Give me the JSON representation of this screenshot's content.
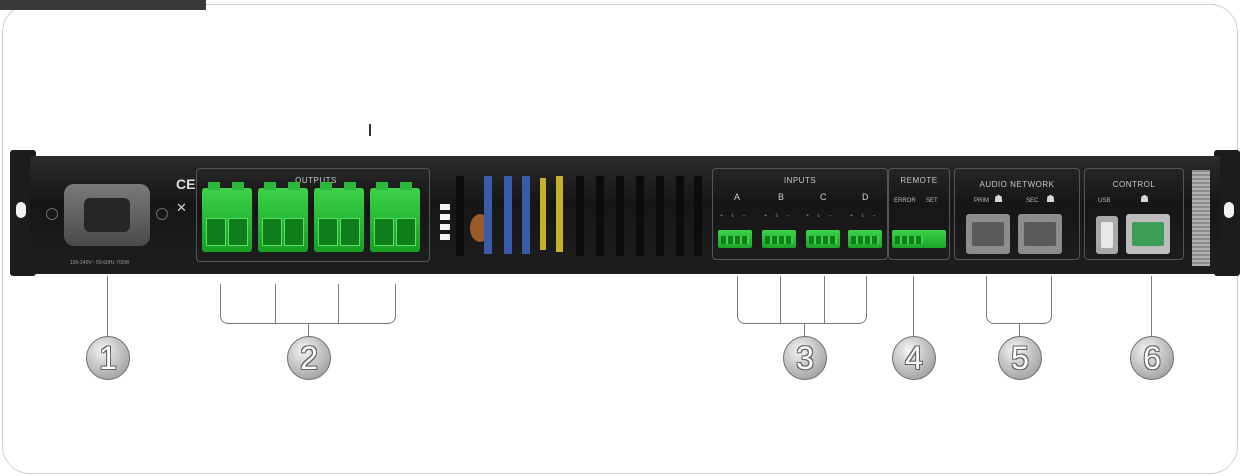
{
  "panel": {
    "outputs_label": "OUTPUTS",
    "inputs_label": "INPUTS",
    "remote_label": "REMOTE",
    "remote_ports": [
      "ERROR",
      "SET"
    ],
    "audio_network_label": "AUDIO NETWORK",
    "audio_network_ports": [
      "PRIM",
      "SEC"
    ],
    "control_label": "CONTROL",
    "usb_label": "USB",
    "input_channels": [
      "A",
      "B",
      "C",
      "D"
    ],
    "input_pins": "+  ⏚  −",
    "ce_mark": "CE",
    "power_print": "100-240V~ 50-60Hz 700W"
  },
  "callouts": [
    {
      "number": "1",
      "meaning": "power"
    },
    {
      "number": "2",
      "meaning": "outputs"
    },
    {
      "number": "3",
      "meaning": "inputs"
    },
    {
      "number": "4",
      "meaning": "remote"
    },
    {
      "number": "5",
      "meaning": "audio-network"
    },
    {
      "number": "6",
      "meaning": "control"
    }
  ],
  "icons": {
    "network": "network-icon",
    "ground": "ground-icon",
    "weee": "weee-icon"
  },
  "colors": {
    "connector_green": "#2ac23a",
    "chassis": "#1e1e1e",
    "bubble": "#bdbdbd"
  }
}
